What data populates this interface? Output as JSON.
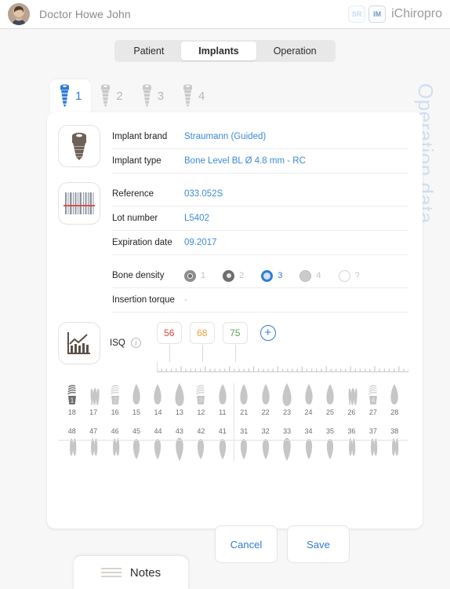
{
  "header": {
    "doctor_name": "Doctor Howe John",
    "brand_name": "iChiropro",
    "badge_sr": "SR",
    "badge_im": "IM",
    "avatar_icon": "user-photo"
  },
  "segmented": {
    "items": [
      {
        "label": "Patient",
        "active": false
      },
      {
        "label": "Implants",
        "active": true
      },
      {
        "label": "Operation",
        "active": false
      }
    ]
  },
  "side_title": "Operation data",
  "implant_tabs": [
    {
      "label": "1",
      "active": true
    },
    {
      "label": "2",
      "active": false
    },
    {
      "label": "3",
      "active": false
    },
    {
      "label": "4",
      "active": false
    }
  ],
  "implant_section": {
    "icon": "implant-screw-icon",
    "fields": [
      {
        "label": "Implant brand",
        "value": "Straumann (Guided)"
      },
      {
        "label": "Implant type",
        "value": "Bone Level BL Ø 4.8 mm - RC"
      }
    ]
  },
  "barcode_section": {
    "icon": "barcode-scan-icon",
    "fields": [
      {
        "label": "Reference",
        "value": "033.052S"
      },
      {
        "label": "Lot number",
        "value": "L5402"
      },
      {
        "label": "Expiration date",
        "value": "09.2017"
      }
    ]
  },
  "bone_density": {
    "label": "Bone density",
    "options": [
      {
        "label": "1",
        "selected": false
      },
      {
        "label": "2",
        "selected": false
      },
      {
        "label": "3",
        "selected": true
      },
      {
        "label": "4",
        "selected": false
      },
      {
        "label": "?",
        "selected": false
      }
    ]
  },
  "insertion_torque": {
    "label": "Insertion torque",
    "value": "-"
  },
  "isq": {
    "icon": "chart-bars-icon",
    "label": "ISQ",
    "info_icon": "info-icon",
    "add_icon": "plus-circle-icon",
    "add_label": "+",
    "measurements": [
      {
        "value": "56",
        "color": "#e0453a",
        "tone": "red",
        "position_pct": 16
      },
      {
        "value": "68",
        "color": "#e8a33d",
        "tone": "orange",
        "position_pct": 36
      },
      {
        "value": "75",
        "color": "#5aa552",
        "tone": "green",
        "position_pct": 56
      }
    ]
  },
  "tooth_chart": {
    "upper_right": [
      {
        "num": "18",
        "type": "implant",
        "implant_index": "1",
        "active": true
      },
      {
        "num": "17",
        "type": "molar"
      },
      {
        "num": "16",
        "type": "implant",
        "implant_index": "2",
        "active": false
      },
      {
        "num": "15",
        "type": "incisor"
      },
      {
        "num": "14",
        "type": "incisor"
      },
      {
        "num": "13",
        "type": "canine"
      },
      {
        "num": "12",
        "type": "implant",
        "implant_index": "3",
        "active": false
      },
      {
        "num": "11",
        "type": "incisor"
      }
    ],
    "upper_left": [
      {
        "num": "21",
        "type": "incisor"
      },
      {
        "num": "22",
        "type": "incisor"
      },
      {
        "num": "23",
        "type": "canine"
      },
      {
        "num": "24",
        "type": "incisor"
      },
      {
        "num": "25",
        "type": "incisor"
      },
      {
        "num": "26",
        "type": "molar"
      },
      {
        "num": "27",
        "type": "implant",
        "implant_index": "4",
        "active": false
      },
      {
        "num": "28",
        "type": "incisor"
      }
    ],
    "lower_right": [
      {
        "num": "48",
        "type": "molar-lower"
      },
      {
        "num": "47",
        "type": "molar-lower"
      },
      {
        "num": "46",
        "type": "molar-lower"
      },
      {
        "num": "45",
        "type": "incisor-lower"
      },
      {
        "num": "44",
        "type": "incisor-lower"
      },
      {
        "num": "43",
        "type": "canine-lower"
      },
      {
        "num": "42",
        "type": "incisor-lower"
      },
      {
        "num": "41",
        "type": "incisor-lower"
      }
    ],
    "lower_left": [
      {
        "num": "31",
        "type": "incisor-lower"
      },
      {
        "num": "32",
        "type": "incisor-lower"
      },
      {
        "num": "33",
        "type": "canine-lower"
      },
      {
        "num": "34",
        "type": "incisor-lower"
      },
      {
        "num": "35",
        "type": "incisor-lower"
      },
      {
        "num": "36",
        "type": "molar-lower"
      },
      {
        "num": "37",
        "type": "molar-lower"
      },
      {
        "num": "38",
        "type": "molar-lower"
      }
    ]
  },
  "footer": {
    "cancel_label": "Cancel",
    "save_label": "Save",
    "notes_label": "Notes",
    "notes_icon": "hamburger-icon"
  },
  "colors": {
    "accent": "#2f7bd6",
    "link": "#3b8bd8",
    "page_bg": "#f7f7f7",
    "card_bg": "#ffffff",
    "side_title": "#cfdff2",
    "isq_red": "#e0453a",
    "isq_orange": "#e8a33d",
    "isq_green": "#5aa552"
  }
}
